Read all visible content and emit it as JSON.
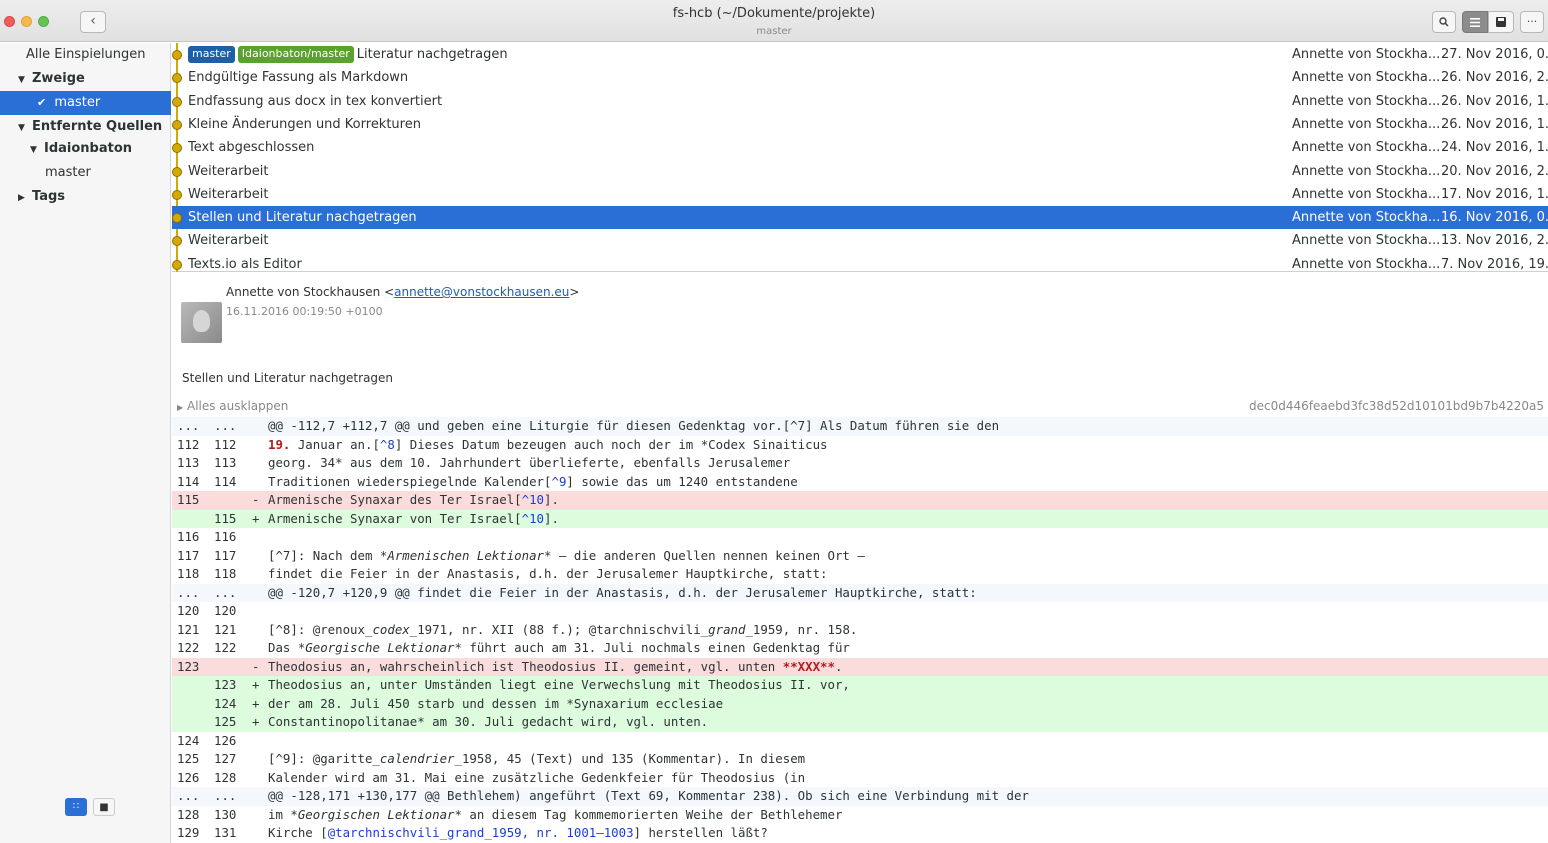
{
  "window": {
    "title": "fs-hcb (~/Dokumente/projekte)",
    "subtitle": "master"
  },
  "toolbar": {
    "back_icon": "chevron-left-icon",
    "search_icon": "search-icon",
    "list_icon": "list-icon",
    "save_icon": "disk-icon",
    "more_label": "···"
  },
  "sidebar": {
    "all_commits": "Alle Einspielungen",
    "branches_header": "Zweige",
    "branch_master": "master",
    "remotes_header": "Entfernte Quellen",
    "remote_name": "Idaionbaton",
    "remote_branch": "master",
    "tags_header": "Tags"
  },
  "commits": [
    {
      "subject": "Literatur nachgetragen",
      "author": "Annette von Stockha...",
      "date": "27. Nov 2016, 0...",
      "labels": [
        "master",
        "Idaionbaton/master"
      ]
    },
    {
      "subject": "Endgültige Fassung als Markdown",
      "author": "Annette von Stockha...",
      "date": "26. Nov 2016, 2..."
    },
    {
      "subject": "Endfassung aus docx in tex konvertiert",
      "author": "Annette von Stockha...",
      "date": "26. Nov 2016, 1..."
    },
    {
      "subject": "Kleine Änderungen und Korrekturen",
      "author": "Annette von Stockha...",
      "date": "26. Nov 2016, 1..."
    },
    {
      "subject": "Text abgeschlossen",
      "author": "Annette von Stockha...",
      "date": "24. Nov 2016, 1..."
    },
    {
      "subject": "Weiterarbeit",
      "author": "Annette von Stockha...",
      "date": "20. Nov 2016, 2..."
    },
    {
      "subject": "Weiterarbeit",
      "author": "Annette von Stockha...",
      "date": "17. Nov 2016, 1..."
    },
    {
      "subject": "Stellen und Literatur nachgetragen",
      "author": "Annette von Stockha...",
      "date": "16. Nov 2016, 0...",
      "selected": true
    },
    {
      "subject": "Weiterarbeit",
      "author": "Annette von Stockha...",
      "date": "13. Nov 2016, 2..."
    },
    {
      "subject": "Texts.io als Editor",
      "author": "Annette von Stockha...",
      "date": "7. Nov 2016, 19..."
    }
  ],
  "detail": {
    "author_name": "Annette von Stockhausen",
    "author_email": "annette@vonstockhausen.eu",
    "date": "16.11.2016 00:19:50 +0100",
    "message": "Stellen und Literatur nachgetragen",
    "expand_all": "Alles ausklappen",
    "hash": "dec0d446feaebd3fc38d52d10101bd9b7b4220a5"
  },
  "diff": [
    {
      "type": "hunk",
      "a": "...",
      "b": "...",
      "text": "@@ -112,7 +112,7 @@ und geben eine Liturgie für diesen Gedenktag vor.[^7] Als Datum führen sie den"
    },
    {
      "type": "ctx",
      "a": "112",
      "b": "112",
      "parts": [
        [
          "red",
          "19."
        ],
        [
          "",
          " Januar an.["
        ],
        [
          "blue",
          "^8"
        ],
        [
          "",
          "] Dieses Datum bezeugen auch noch der im *Codex Sinaiticus"
        ]
      ]
    },
    {
      "type": "ctx",
      "a": "113",
      "b": "113",
      "text": "georg. 34* aus dem 10. Jahrhundert überlieferte, ebenfalls Jerusalemer"
    },
    {
      "type": "ctx",
      "a": "114",
      "b": "114",
      "parts": [
        [
          "",
          "Traditionen wiederspiegelnde Kalender["
        ],
        [
          "blue",
          "^9"
        ],
        [
          "",
          "] sowie das um 1240 entstandene"
        ]
      ]
    },
    {
      "type": "del",
      "a": "115",
      "b": "",
      "sign": "-",
      "parts": [
        [
          "",
          "Armenische Synaxar des Ter Israel["
        ],
        [
          "blue",
          "^10"
        ],
        [
          "",
          "]."
        ]
      ]
    },
    {
      "type": "add",
      "a": "",
      "b": "115",
      "sign": "+",
      "parts": [
        [
          "",
          "Armenische Synaxar von Ter Israel["
        ],
        [
          "blue",
          "^10"
        ],
        [
          "",
          "]."
        ]
      ]
    },
    {
      "type": "ctx",
      "a": "116",
      "b": "116",
      "text": ""
    },
    {
      "type": "ctx",
      "a": "117",
      "b": "117",
      "parts": [
        [
          "",
          "[^7]: Nach dem "
        ],
        [
          "it",
          "*Armenischen Lektionar*"
        ],
        [
          "",
          " – die anderen Quellen nennen keinen Ort –"
        ]
      ]
    },
    {
      "type": "ctx",
      "a": "118",
      "b": "118",
      "text": "findet die Feier in der Anastasis, d.h. der Jerusalemer Hauptkirche, statt:"
    },
    {
      "type": "hunk",
      "a": "...",
      "b": "...",
      "text": "@@ -120,7 +120,9 @@ findet die Feier in der Anastasis, d.h. der Jerusalemer Hauptkirche, statt:"
    },
    {
      "type": "ctx",
      "a": "120",
      "b": "120",
      "text": ""
    },
    {
      "type": "ctx",
      "a": "121",
      "b": "121",
      "parts": [
        [
          "",
          "[^8]: @renoux_"
        ],
        [
          "it",
          "codex"
        ],
        [
          "",
          "_1971, nr. XII (88 f.); @tarchnischvili_"
        ],
        [
          "it",
          "grand"
        ],
        [
          "",
          "_1959, nr. 158."
        ]
      ]
    },
    {
      "type": "ctx",
      "a": "122",
      "b": "122",
      "parts": [
        [
          "",
          "Das "
        ],
        [
          "it",
          "*Georgische Lektionar*"
        ],
        [
          "",
          " führt auch am 31. Juli nochmals einen Gedenktag für"
        ]
      ]
    },
    {
      "type": "del",
      "a": "123",
      "b": "",
      "sign": "-",
      "parts": [
        [
          "",
          "Theodosius an, wahrscheinlich ist Theodosius II. gemeint, vgl. unten "
        ],
        [
          "red",
          "**XXX**"
        ],
        [
          "",
          "."
        ]
      ]
    },
    {
      "type": "add",
      "a": "",
      "b": "123",
      "sign": "+",
      "text": "Theodosius an, unter Umständen liegt eine Verwechslung mit Theodosius II. vor,"
    },
    {
      "type": "add",
      "a": "",
      "b": "124",
      "sign": "+",
      "text": "der am 28. Juli 450 starb und dessen im *Synaxarium ecclesiae"
    },
    {
      "type": "add",
      "a": "",
      "b": "125",
      "sign": "+",
      "text": "Constantinopolitanae* am 30. Juli gedacht wird, vgl. unten."
    },
    {
      "type": "ctx",
      "a": "124",
      "b": "126",
      "text": ""
    },
    {
      "type": "ctx",
      "a": "125",
      "b": "127",
      "parts": [
        [
          "",
          "[^9]: @garitte_"
        ],
        [
          "it",
          "calendrier"
        ],
        [
          "",
          "_1958, 45 (Text) und 135 (Kommentar). In diesem"
        ]
      ]
    },
    {
      "type": "ctx",
      "a": "126",
      "b": "128",
      "text": "Kalender wird am 31. Mai eine zusätzliche Gedenkfeier für Theodosius (in"
    },
    {
      "type": "hunk",
      "a": "...",
      "b": "...",
      "text": "@@ -128,171 +130,177 @@ Bethlehem) angeführt (Text 69, Kommentar 238). Ob sich eine Verbindung mit der"
    },
    {
      "type": "ctx",
      "a": "128",
      "b": "130",
      "parts": [
        [
          "",
          "im "
        ],
        [
          "it",
          "*Georgischen Lektionar*"
        ],
        [
          "",
          " an diesem Tag kommemorierten Weihe der Bethlehemer"
        ]
      ]
    },
    {
      "type": "ctx",
      "a": "129",
      "b": "131",
      "parts": [
        [
          "",
          "Kirche ["
        ],
        [
          "blue",
          "@tarchnischvili_grand_1959, nr. 1001–1003"
        ],
        [
          "",
          "] herstellen läßt?"
        ]
      ]
    }
  ],
  "colors": {
    "accent": "#2a6fd6",
    "graph": "#d4a900",
    "label_local": "#1f5fa6",
    "label_remote": "#5aa22f",
    "added_bg": "#ddfbdd",
    "removed_bg": "#fbdcdc"
  }
}
